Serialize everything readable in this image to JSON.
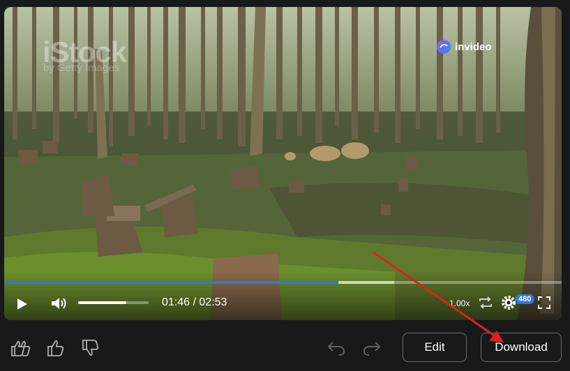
{
  "video": {
    "watermark_primary": "iStock",
    "watermark_secondary": "by Getty Images",
    "brand_name": "invideo",
    "progress_fraction": 0.6,
    "buffered_fraction": 0.1
  },
  "controls": {
    "current_time": "01:46",
    "separator": " / ",
    "duration": "02:53",
    "playback_speed": "1.00x",
    "quality_badge": "480",
    "volume_fraction": 0.68
  },
  "icons": {
    "play": "play-icon",
    "volume": "volume-icon",
    "loop": "loop-icon",
    "settings": "gear-icon",
    "fullscreen": "fullscreen-icon",
    "double_like": "double-thumbs-up-icon",
    "like": "thumbs-up-icon",
    "dislike": "thumbs-down-icon",
    "undo": "undo-icon",
    "redo": "redo-icon"
  },
  "toolbar": {
    "edit_label": "Edit",
    "download_label": "Download"
  },
  "colors": {
    "accent": "#2f78d6",
    "annotation_arrow": "#e0201c",
    "background": "#18191b"
  }
}
